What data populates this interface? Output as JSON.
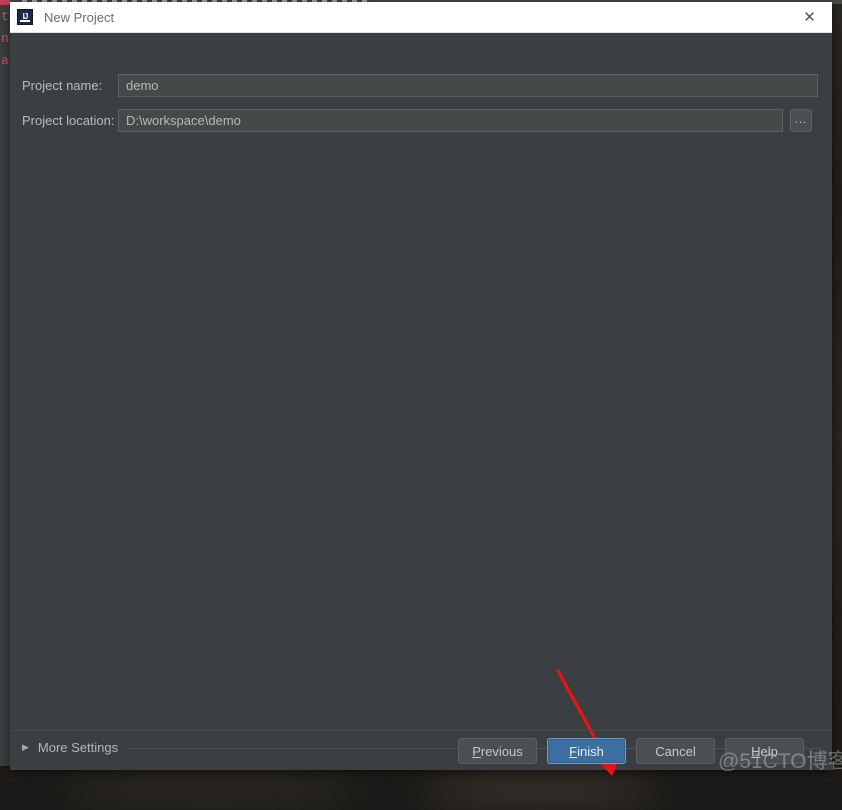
{
  "window": {
    "title": "New Project",
    "app_icon": "intellij-idea-icon",
    "icon_letters": "IJ",
    "close_label": "✕"
  },
  "form": {
    "fields": [
      {
        "label": "Project name:",
        "value": "demo",
        "placeholder": "",
        "name": "project-name"
      },
      {
        "label": "Project location:",
        "value": "D:\\workspace\\demo",
        "placeholder": "",
        "name": "project-location"
      }
    ],
    "browse_label": "..."
  },
  "more_settings": {
    "label": "More Settings",
    "arrow": "▶",
    "expanded": false
  },
  "buttons": {
    "previous": {
      "label": "Previous",
      "mnemonic": "P",
      "primary": false
    },
    "finish": {
      "label": "Finish",
      "mnemonic": "F",
      "primary": true
    },
    "cancel": {
      "label": "Cancel",
      "mnemonic": "",
      "primary": false
    },
    "help": {
      "label": "Help",
      "mnemonic": "H",
      "primary": false
    }
  },
  "annotation": {
    "arrow_color": "#ee1111",
    "target": "finish-button"
  },
  "watermark": {
    "text": "@51CTO博客"
  },
  "backdrop": {
    "left_fragments": [
      "t",
      "n",
      "a"
    ]
  },
  "colors": {
    "dialog_bg": "#3c3f41",
    "titlebar_bg": "#ffffff",
    "field_bg": "#45494a",
    "primary_button": "#3c6e9f",
    "accent_red": "#ee1111"
  }
}
